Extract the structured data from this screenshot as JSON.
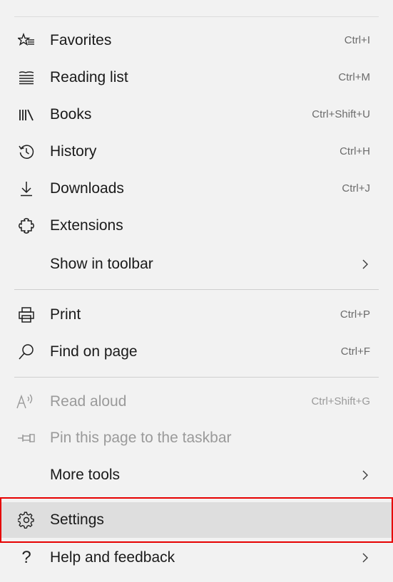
{
  "menu": {
    "items": [
      {
        "label": "Favorites",
        "shortcut": "Ctrl+I",
        "icon": "favorites-star-list-icon"
      },
      {
        "label": "Reading list",
        "shortcut": "Ctrl+M",
        "icon": "reading-list-icon"
      },
      {
        "label": "Books",
        "shortcut": "Ctrl+Shift+U",
        "icon": "books-icon"
      },
      {
        "label": "History",
        "shortcut": "Ctrl+H",
        "icon": "history-clock-icon"
      },
      {
        "label": "Downloads",
        "shortcut": "Ctrl+J",
        "icon": "download-arrow-icon"
      },
      {
        "label": "Extensions",
        "shortcut": "",
        "icon": "extensions-puzzle-icon"
      },
      {
        "label": "Show in toolbar",
        "submenu": true
      },
      {
        "label": "Print",
        "shortcut": "Ctrl+P",
        "icon": "printer-icon"
      },
      {
        "label": "Find on page",
        "shortcut": "Ctrl+F",
        "icon": "search-icon"
      },
      {
        "label": "Read aloud",
        "shortcut": "Ctrl+Shift+G",
        "icon": "read-aloud-icon",
        "disabled": true
      },
      {
        "label": "Pin this page to the taskbar",
        "icon": "pin-icon",
        "disabled": true
      },
      {
        "label": "More tools",
        "submenu": true
      },
      {
        "label": "Settings",
        "icon": "gear-icon",
        "hovered": true
      },
      {
        "label": "Help and feedback",
        "submenu": true,
        "icon": "question-mark-icon"
      }
    ]
  },
  "colors": {
    "menu_background": "#f2f2f2",
    "hover_background": "#dedede",
    "highlight_border": "#e60000",
    "text": "#1a1a1a",
    "disabled_text": "#9a9a9a"
  }
}
